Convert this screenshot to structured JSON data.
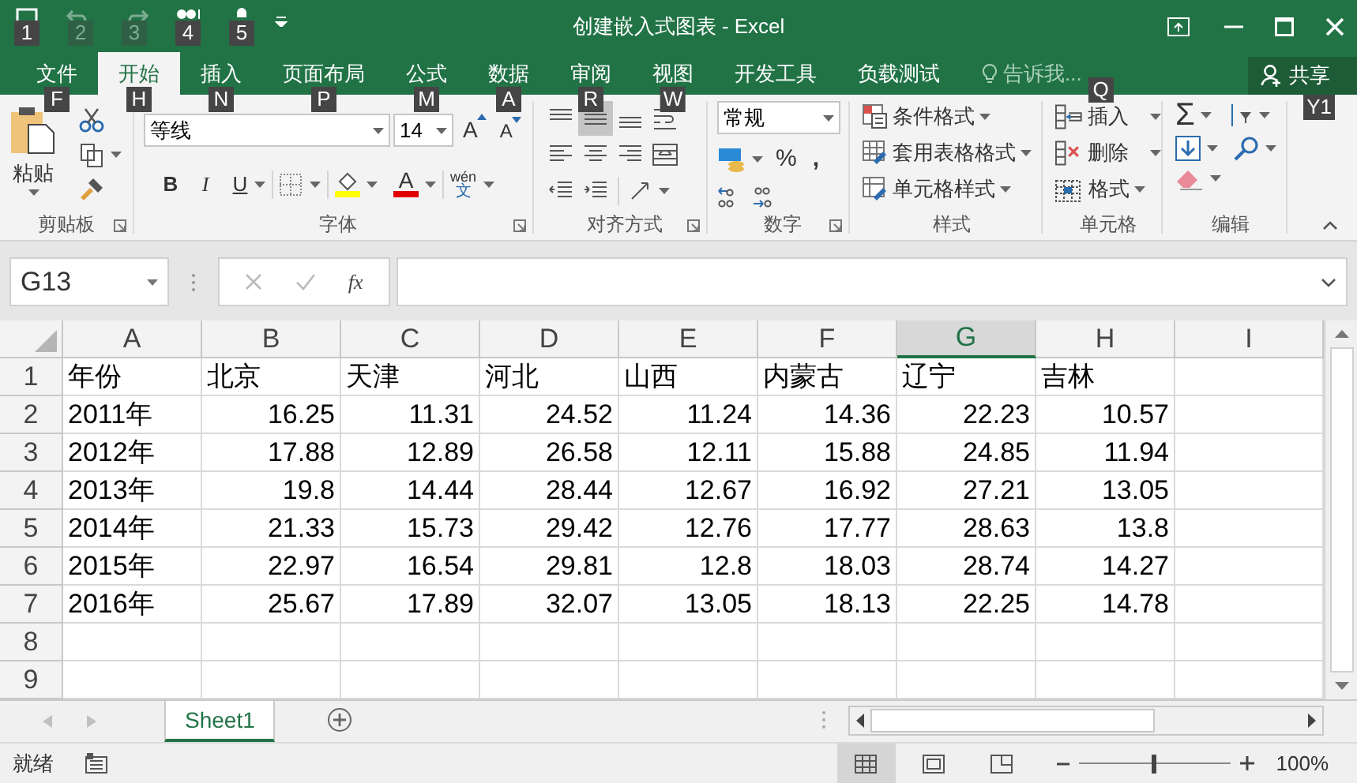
{
  "window": {
    "title": "创建嵌入式图表 - Excel"
  },
  "quick_access": [
    {
      "kind": "save",
      "keytip": "1",
      "disabled": false
    },
    {
      "kind": "undo",
      "keytip": "2",
      "disabled": true
    },
    {
      "kind": "redo",
      "keytip": "3",
      "disabled": true
    },
    {
      "kind": "touch",
      "keytip": "4",
      "disabled": false
    },
    {
      "kind": "mouse",
      "keytip": "5",
      "disabled": false
    }
  ],
  "ribbon_tabs": [
    {
      "label": "文件",
      "keytip": "F",
      "selected": false
    },
    {
      "label": "开始",
      "keytip": "H",
      "selected": true
    },
    {
      "label": "插入",
      "keytip": "N",
      "selected": false
    },
    {
      "label": "页面布局",
      "keytip": "P",
      "selected": false
    },
    {
      "label": "公式",
      "keytip": "M",
      "selected": false
    },
    {
      "label": "数据",
      "keytip": "A",
      "selected": false
    },
    {
      "label": "审阅",
      "keytip": "R",
      "selected": false
    },
    {
      "label": "视图",
      "keytip": "W",
      "selected": false
    },
    {
      "label": "开发工具",
      "selected": false
    },
    {
      "label": "负载测试",
      "selected": false
    }
  ],
  "tell_me": {
    "placeholder": "告诉我...",
    "keytip": "Q"
  },
  "share": {
    "label": "共享",
    "keytip": "Y1"
  },
  "ribbon": {
    "clipboard": {
      "label": "剪贴板",
      "paste": "粘贴"
    },
    "font": {
      "label": "字体",
      "font_name": "等线",
      "font_size": "14",
      "grow": "A",
      "shrink": "A",
      "bold": "B",
      "italic": "I",
      "underline": "U",
      "font_color": "A",
      "phonetic_top": "wén",
      "phonetic_bottom": "文"
    },
    "alignment": {
      "label": "对齐方式",
      "vertical_align": [
        {
          "kind": "top",
          "selected": false
        },
        {
          "kind": "middle",
          "selected": true
        },
        {
          "kind": "bottom",
          "selected": false
        }
      ]
    },
    "number": {
      "label": "数字",
      "format": "常规",
      "percent": "%",
      "comma": ","
    },
    "styles": {
      "label": "样式",
      "items": [
        "条件格式",
        "套用表格格式",
        "单元格样式"
      ]
    },
    "cells": {
      "label": "单元格",
      "items": [
        "插入",
        "删除",
        "格式"
      ]
    },
    "editing": {
      "label": "编辑",
      "autosum": "Σ"
    }
  },
  "formula_bar": {
    "name_box": "G13",
    "function_label": "fx"
  },
  "sheet": {
    "columns": [
      {
        "label": "A",
        "selected": false
      },
      {
        "label": "B",
        "selected": false
      },
      {
        "label": "C",
        "selected": false
      },
      {
        "label": "D",
        "selected": false
      },
      {
        "label": "E",
        "selected": false
      },
      {
        "label": "F",
        "selected": false
      },
      {
        "label": "G",
        "selected": true
      },
      {
        "label": "H",
        "selected": false
      },
      {
        "label": "I",
        "selected": false
      }
    ],
    "rows": [
      {
        "header": "1",
        "cells": [
          "年份",
          "北京",
          "天津",
          "河北",
          "山西",
          "内蒙古",
          "辽宁",
          "吉林"
        ]
      },
      {
        "header": "2",
        "cells": [
          "2011年",
          "16.25",
          "11.31",
          "24.52",
          "11.24",
          "14.36",
          "22.23",
          "10.57"
        ]
      },
      {
        "header": "3",
        "cells": [
          "2012年",
          "17.88",
          "12.89",
          "26.58",
          "12.11",
          "15.88",
          "24.85",
          "11.94"
        ]
      },
      {
        "header": "4",
        "cells": [
          "2013年",
          "19.8",
          "14.44",
          "28.44",
          "12.67",
          "16.92",
          "27.21",
          "13.05"
        ]
      },
      {
        "header": "5",
        "cells": [
          "2014年",
          "21.33",
          "15.73",
          "29.42",
          "12.76",
          "17.77",
          "28.63",
          "13.8"
        ]
      },
      {
        "header": "6",
        "cells": [
          "2015年",
          "22.97",
          "16.54",
          "29.81",
          "12.8",
          "18.03",
          "28.74",
          "14.27"
        ]
      },
      {
        "header": "7",
        "cells": [
          "2016年",
          "25.67",
          "17.89",
          "32.07",
          "13.05",
          "18.13",
          "22.25",
          "14.78"
        ]
      },
      {
        "header": "8"
      },
      {
        "header": "9"
      }
    ]
  },
  "sheet_tabs": [
    {
      "label": "Sheet1",
      "selected": true
    }
  ],
  "status_bar": {
    "status": "就绪",
    "views": [
      {
        "kind": "normal",
        "selected": true
      },
      {
        "kind": "page_layout",
        "selected": false
      },
      {
        "kind": "page_break",
        "selected": false
      }
    ],
    "zoom": {
      "level": 0.5,
      "reading": "100%"
    }
  }
}
